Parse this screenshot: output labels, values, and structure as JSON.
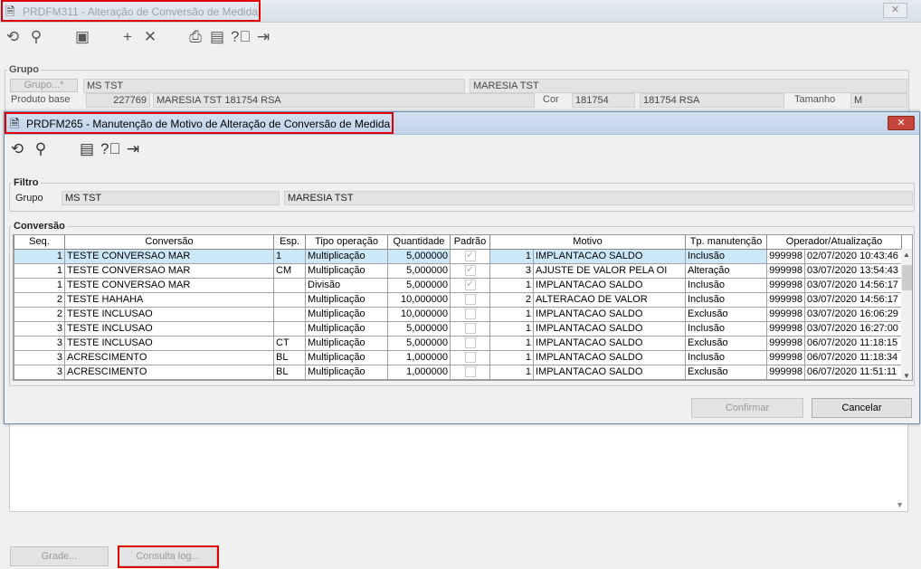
{
  "outer": {
    "title": "PRDFM311 - Alteração de Conversão de Medida",
    "close_icon": "close-icon",
    "toolbar": [
      "undo-icon",
      "search-icon",
      "save-icon",
      "add-icon",
      "delete-icon",
      "print-icon",
      "calendar-icon",
      "help-icon",
      "exit-icon"
    ],
    "grupo": {
      "legend": "Grupo",
      "grupo_button": "Grupo...*",
      "grupo_code": "MS TST",
      "grupo_name": "MARESIA TST",
      "produto_label": "Produto base",
      "produto_code": "227769",
      "produto_name": "MARESIA TST 181754 RSA",
      "cor_label": "Cor",
      "cor_code": "181754",
      "cor_name": "181754 RSA",
      "tamanho_label": "Tamanho",
      "tamanho": "M"
    },
    "buttons": {
      "grade": "Grade...",
      "consulta_log": "Consulta log..."
    }
  },
  "modal": {
    "title": "PRDFM265 - Manutenção de Motivo de Alteração de Conversão de Medida",
    "toolbar": [
      "undo-icon",
      "search-icon",
      "calendar-icon",
      "help-icon",
      "exit-icon"
    ],
    "filtro": {
      "legend": "Filtro",
      "grupo_label": "Grupo",
      "grupo_code": "MS TST",
      "grupo_name": "MARESIA TST"
    },
    "conversao": {
      "legend": "Conversão",
      "columns": [
        "Seq.",
        "Conversão",
        "Esp.",
        "Tipo operação",
        "Quantidade",
        "Padrão",
        "Motivo",
        "Tp. manutenção",
        "Operador/Atualização"
      ],
      "rows": [
        {
          "seq": "1",
          "conv": "TESTE CONVERSAO MAR",
          "esp": "1",
          "tipo": "Multiplicação",
          "qtd": "5,000000",
          "padrao": true,
          "mot_n": "1",
          "motivo": "IMPLANTACAO SALDO",
          "tp": "Inclusão",
          "op": "999998",
          "dt": "02/07/2020 10:43:46"
        },
        {
          "seq": "1",
          "conv": "TESTE CONVERSAO MAR",
          "esp": "CM",
          "tipo": "Multiplicação",
          "qtd": "5,000000",
          "padrao": true,
          "mot_n": "3",
          "motivo": "AJUSTE DE VALOR PELA OI",
          "tp": "Alteração",
          "op": "999998",
          "dt": "03/07/2020 13:54:43"
        },
        {
          "seq": "1",
          "conv": "TESTE CONVERSAO MAR",
          "esp": "",
          "tipo": "Divisão",
          "qtd": "5,000000",
          "padrao": true,
          "mot_n": "1",
          "motivo": "IMPLANTACAO SALDO",
          "tp": "Inclusão",
          "op": "999998",
          "dt": "03/07/2020 14:56:17"
        },
        {
          "seq": "2",
          "conv": "TESTE HAHAHA",
          "esp": "",
          "tipo": "Multiplicação",
          "qtd": "10,000000",
          "padrao": false,
          "mot_n": "2",
          "motivo": "ALTERACAO DE VALOR",
          "tp": "Inclusão",
          "op": "999998",
          "dt": "03/07/2020 14:56:17"
        },
        {
          "seq": "2",
          "conv": "TESTE INCLUSAO",
          "esp": "",
          "tipo": "Multiplicação",
          "qtd": "10,000000",
          "padrao": false,
          "mot_n": "1",
          "motivo": "IMPLANTACAO SALDO",
          "tp": "Exclusão",
          "op": "999998",
          "dt": "03/07/2020 16:06:29"
        },
        {
          "seq": "3",
          "conv": "TESTE INCLUSAO",
          "esp": "",
          "tipo": "Multiplicação",
          "qtd": "5,000000",
          "padrao": false,
          "mot_n": "1",
          "motivo": "IMPLANTACAO SALDO",
          "tp": "Inclusão",
          "op": "999998",
          "dt": "03/07/2020 16:27:00"
        },
        {
          "seq": "3",
          "conv": "TESTE INCLUSAO",
          "esp": "CT",
          "tipo": "Multiplicação",
          "qtd": "5,000000",
          "padrao": false,
          "mot_n": "1",
          "motivo": "IMPLANTACAO SALDO",
          "tp": "Exclusão",
          "op": "999998",
          "dt": "06/07/2020 11:18:15"
        },
        {
          "seq": "3",
          "conv": "ACRESCIMENTO",
          "esp": "BL",
          "tipo": "Multiplicação",
          "qtd": "1,000000",
          "padrao": false,
          "mot_n": "1",
          "motivo": "IMPLANTACAO SALDO",
          "tp": "Inclusão",
          "op": "999998",
          "dt": "06/07/2020 11:18:34"
        },
        {
          "seq": "3",
          "conv": "ACRESCIMENTO",
          "esp": "BL",
          "tipo": "Multiplicação",
          "qtd": "1,000000",
          "padrao": false,
          "mot_n": "1",
          "motivo": "IMPLANTACAO SALDO",
          "tp": "Exclusão",
          "op": "999998",
          "dt": "06/07/2020 11:51:11"
        }
      ]
    },
    "buttons": {
      "confirmar": "Confirmar",
      "cancelar": "Cancelar"
    }
  },
  "colors": {
    "selected_row": "#cce8f7",
    "highlight_box": "#e00000"
  }
}
